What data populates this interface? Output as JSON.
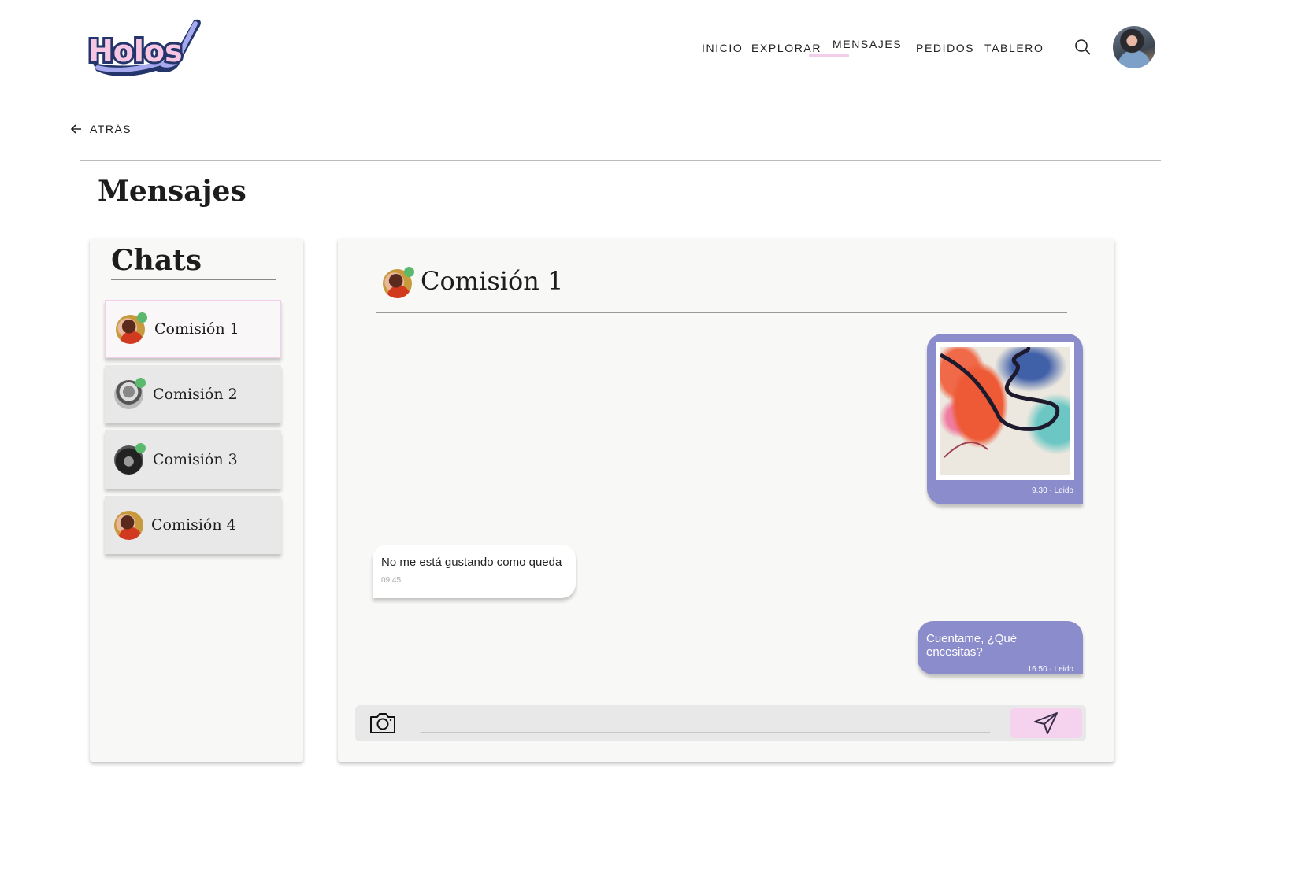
{
  "brand": {
    "logo_text": "Holos"
  },
  "nav": {
    "items": [
      "INICIO",
      "EXPLORAR",
      "MENSAJES",
      "PEDIDOS",
      "TABLERO"
    ],
    "active": "MENSAJES"
  },
  "back_label": "ATRÁS",
  "page_title": "Mensajes",
  "sidebar": {
    "title": "Chats",
    "chats": [
      {
        "label": "Comisión 1",
        "online": true,
        "active": true
      },
      {
        "label": "Comisión 2",
        "online": true
      },
      {
        "label": "Comisión 3",
        "online": true
      },
      {
        "label": "Comisión 4",
        "online": false
      }
    ]
  },
  "conversation": {
    "title": "Comisión 1",
    "messages": [
      {
        "type": "image",
        "direction": "sent",
        "meta": "9.30 · Leido"
      },
      {
        "type": "text",
        "direction": "received",
        "text": "No me está gustando como queda",
        "meta": "09.45"
      },
      {
        "type": "text",
        "direction": "sent",
        "text": "Cuentame, ¿Qué encesitas?",
        "meta": "16.50 · Leido"
      }
    ],
    "input": {
      "value": "",
      "placeholder": ""
    }
  },
  "colors": {
    "accent_pink": "#f4cdea",
    "bubble_purple": "#8b8ccc",
    "online_green": "#5ab96c"
  }
}
